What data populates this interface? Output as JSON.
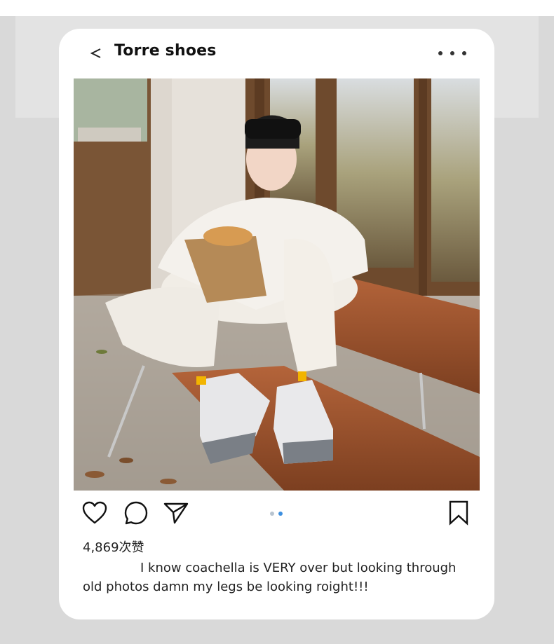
{
  "header": {
    "title": "Torre shoes"
  },
  "post": {
    "likes": "4,869次赞",
    "caption": "I know coachella is VERY over but looking through old photos damn my legs be looking roight!!!"
  },
  "icons": {
    "back": "chevron-left-icon",
    "more": "more-horizontal-icon",
    "like": "heart-icon",
    "comment": "comment-icon",
    "share": "send-icon",
    "save": "bookmark-icon"
  },
  "carousel": {
    "active_index": 1,
    "count": 2
  },
  "colors": {
    "accent": "#3d8fe0",
    "inactive_dot": "#b8c4d0",
    "card": "#ffffff",
    "background": "#d9d9d9"
  }
}
